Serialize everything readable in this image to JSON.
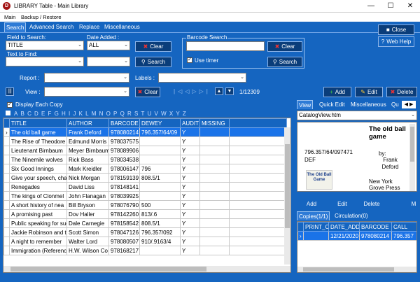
{
  "window": {
    "title": "LIBRARY Table - Main Library",
    "app_icon": "D"
  },
  "menu": [
    "Main",
    "Backup / Restore"
  ],
  "top_tabs": [
    "Search",
    "Advanced Search",
    "Replace",
    "Miscellaneous"
  ],
  "search": {
    "field_label": "Field to Search:",
    "field_value": "TITLE",
    "date_label": "Date Added :",
    "date_value": "ALL",
    "text_label": "Text to Find:",
    "clear": "Clear",
    "search": "Search"
  },
  "barcode": {
    "group_label": "Barcode Search",
    "use_timer": "Use timer",
    "clear": "Clear",
    "search": "Search"
  },
  "right_buttons": {
    "close": "Close",
    "web_help": "Web Help"
  },
  "report_label": "Report :",
  "labels_label": "Labels :",
  "view_label": "View :",
  "view_clear": "Clear",
  "record_count": "1/12309",
  "actions": {
    "add": "Add",
    "edit": "Edit",
    "delete": "Delete"
  },
  "display_each_copy": "Display Each Copy",
  "alphabet": [
    "A",
    "B",
    "C",
    "D",
    "E",
    "F",
    "G",
    "H",
    "I",
    "J",
    "K",
    "L",
    "M",
    "N",
    "O",
    "P",
    "Q",
    "R",
    "S",
    "T",
    "U",
    "V",
    "W",
    "X",
    "Y",
    "Z"
  ],
  "main_table": {
    "columns": [
      "TITLE",
      "AUTHOR",
      "BARCODE",
      "DEWEY",
      "AUDIT",
      "MISSING"
    ],
    "rows": [
      [
        "The old ball game",
        "Frank Deford",
        "978080214",
        "796.357/64/09",
        "Y",
        ""
      ],
      [
        "The Rise of Theodore",
        "Edmund Morris",
        "978037575",
        "",
        "Y",
        ""
      ],
      [
        "Lieutenant Birnbaum",
        "Meyer Birnbaum",
        "978089906",
        "",
        "Y",
        ""
      ],
      [
        "The Ninemile wolves",
        "Rick Bass",
        "978034538",
        "",
        "Y",
        ""
      ],
      [
        "Six Good Innings",
        "Mark Kreidler",
        "978006147",
        "796",
        "Y",
        ""
      ],
      [
        "Give your speech, cha",
        "Nick Morgan",
        "978159139",
        "808.5/1",
        "Y",
        ""
      ],
      [
        "Renegades",
        "David Liss",
        "978148141",
        "",
        "Y",
        ""
      ],
      [
        "The kings of Clonmel",
        "John Flanagan",
        "978039925",
        "",
        "Y",
        ""
      ],
      [
        "A short history of nea",
        "Bill Bryson",
        "978076790",
        "500",
        "Y",
        ""
      ],
      [
        "A promising past",
        "Dov Haller",
        "978142260",
        "813/.6",
        "Y",
        ""
      ],
      [
        "Public speaking for suc",
        "Dale Carnegie",
        "978158542",
        "808.5/1",
        "Y",
        ""
      ],
      [
        "Jackie Robinson and th",
        "Scott Simon",
        "978047126",
        "796.357/092",
        "Y",
        ""
      ],
      [
        "A night to remember",
        "Walter Lord",
        "978080507",
        "910/.9163/4",
        "Y",
        ""
      ],
      [
        "Immigration (Referenc",
        "H.W. Wilson Co",
        "978168217",
        "",
        "Y",
        ""
      ]
    ]
  },
  "right_tabs": [
    "View",
    "Quick Edit",
    "Miscellaneous",
    "Qu"
  ],
  "preview_file": "CatalogView.htm",
  "preview": {
    "title": "The old ball game",
    "by": "by:",
    "author": "Frank Deford",
    "dewey": "796.357/64/097471",
    "def": "DEF",
    "cover_title": "The Old Ball Game",
    "publisher": "New York Grove Press"
  },
  "copies_buttons": {
    "add": "Add",
    "edit": "Edit",
    "delete": "Delete",
    "more": "M"
  },
  "copies_tabs": [
    "Copies(1/1)",
    "Circulation(0)"
  ],
  "copies_table": {
    "columns": [
      "PRINT_C",
      "DATE_ADDI",
      "BARCODE",
      "CALL"
    ],
    "rows": [
      [
        "",
        "12/21/2020",
        "978080214",
        "796.357"
      ]
    ]
  }
}
